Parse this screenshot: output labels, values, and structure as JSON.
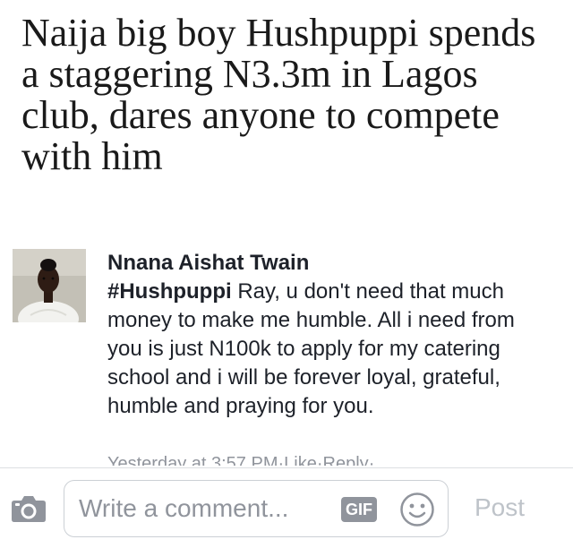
{
  "article": {
    "headline": "Naija big boy Hushpuppi spends a staggering N3.3m in Lagos club, dares anyone to compete with him"
  },
  "comment": {
    "author": "Nnana Aishat Twain",
    "hashtag": "#Hushpuppi",
    "text": " Ray, u don't need that much money to make me humble. All i need from you is just N100k to apply for my catering school and i will be forever loyal, grateful, humble and praying for you.",
    "timestamp": "Yesterday at 3:57 PM",
    "separator": " · ",
    "like_label": "Like",
    "reply_label": "Reply",
    "trailing_separator": " ·"
  },
  "composer": {
    "placeholder": "Write a comment...",
    "gif_label": "GIF",
    "post_label": "Post"
  },
  "icons": {
    "camera": "camera-icon",
    "emoji": "smiley-icon"
  },
  "colors": {
    "text": "#1d2129",
    "muted": "#90949c",
    "post_disabled": "#bec3c9",
    "border": "#ccd0d5"
  }
}
